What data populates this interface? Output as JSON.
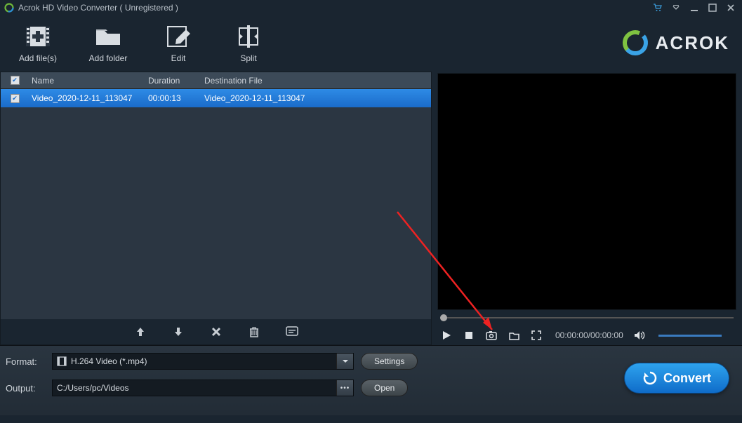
{
  "titlebar": {
    "title": "Acrok HD Video Converter ( Unregistered )"
  },
  "toolbar": {
    "add_files": "Add file(s)",
    "add_folder": "Add folder",
    "edit": "Edit",
    "split": "Split"
  },
  "brand": "ACROK",
  "table": {
    "headers": {
      "name": "Name",
      "duration": "Duration",
      "destination": "Destination File"
    },
    "rows": [
      {
        "name": "Video_2020-12-11_113047",
        "duration": "00:00:13",
        "destination": "Video_2020-12-11_113047"
      }
    ]
  },
  "player": {
    "time": "00:00:00/00:00:00"
  },
  "bottom": {
    "format_label": "Format:",
    "format_value": "H.264 Video (*.mp4)",
    "settings_btn": "Settings",
    "output_label": "Output:",
    "output_value": "C:/Users/pc/Videos",
    "open_btn": "Open",
    "convert_btn": "Convert"
  }
}
